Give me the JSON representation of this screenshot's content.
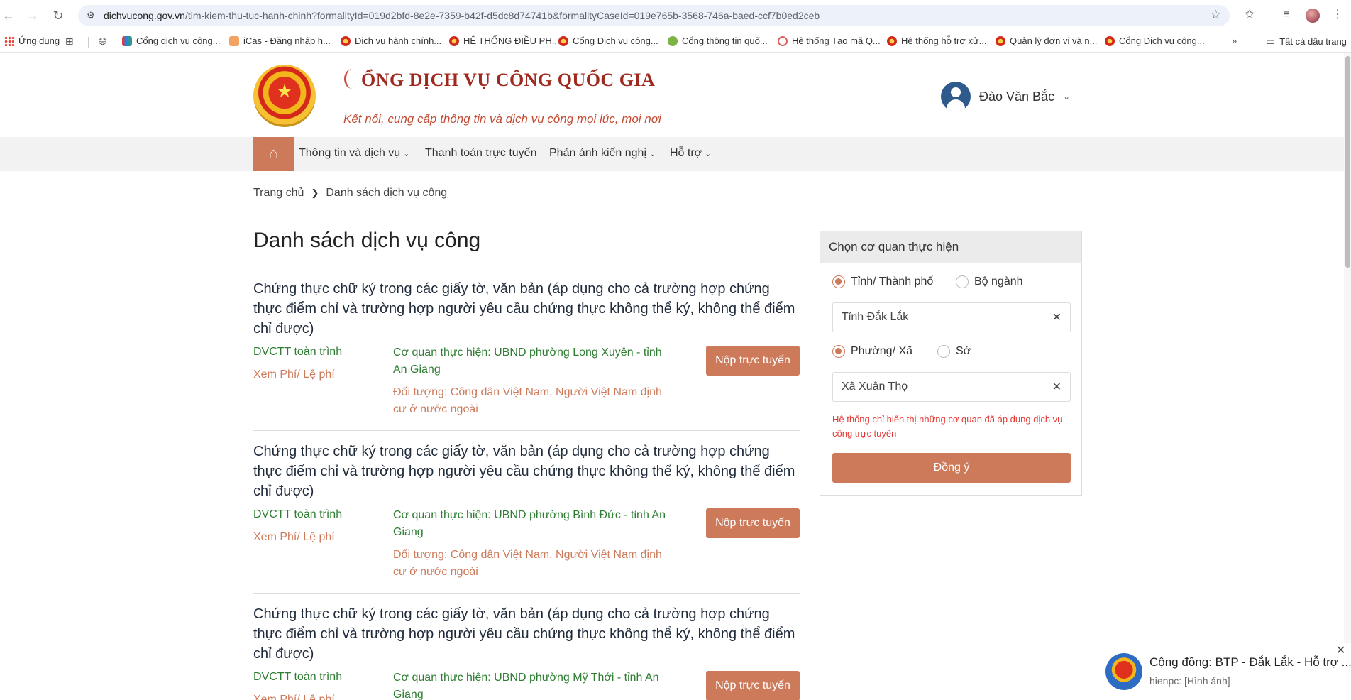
{
  "browser": {
    "url_host": "dichvucong.gov.vn",
    "url_path": "/tim-kiem-thu-tuc-hanh-chinh?formalityId=019d2bfd-8e2e-7359-b42f-d5dc8d74741b&formalityCaseId=019e765b-3568-746a-baed-ccf7b0ed2ceb",
    "bookmarks": [
      {
        "label": "Ứng dụng"
      },
      {
        "label": "Cổng dịch vụ công..."
      },
      {
        "label": "iCas - Đăng nhập h..."
      },
      {
        "label": "Dịch vụ hành chính..."
      },
      {
        "label": "HỆ THỐNG ĐIỀU PH..."
      },
      {
        "label": "Cổng Dịch vụ công..."
      },
      {
        "label": "Cổng thông tin quố..."
      },
      {
        "label": "Hệ thống Tạo mã Q..."
      },
      {
        "label": "Hệ thống hỗ trợ xử..."
      },
      {
        "label": "Quản lý đơn vị và n..."
      },
      {
        "label": "Cổng Dịch vụ công..."
      }
    ],
    "all_bookmarks": "Tất cả dấu trang"
  },
  "header": {
    "logo_text": "ỔNG DỊCH VỤ CÔNG QUỐC GIA",
    "tagline": "Kết nối, cung cấp thông tin và dịch vụ công mọi lúc, mọi nơi",
    "user_name": "Đào Văn Bắc"
  },
  "nav": {
    "items": [
      {
        "label": "Thông tin và dịch vụ"
      },
      {
        "label": "Thanh toán trực tuyến"
      },
      {
        "label": "Phản ánh kiến nghị"
      },
      {
        "label": "Hỗ trợ"
      }
    ]
  },
  "breadcrumb": {
    "home": "Trang chủ",
    "current": "Danh sách dịch vụ công"
  },
  "main": {
    "title": "Danh sách dịch vụ công",
    "services": [
      {
        "name": "Chứng thực chữ ký trong các giấy tờ, văn bản (áp dụng cho cả trường hợp chứng thực điểm chỉ và trường hợp người yêu cầu chứng thực không thể ký, không thể điểm chỉ được)",
        "type": "DVCTT toàn trình",
        "fee": "Xem Phí/ Lệ phí",
        "agency": "Cơ quan thực hiện: UBND phường Long Xuyên - tỉnh An Giang",
        "target": "Đối tượng: Công dân Việt Nam, Người Việt Nam định cư ở nước ngoài",
        "button": "Nộp trực tuyến"
      },
      {
        "name": "Chứng thực chữ ký trong các giấy tờ, văn bản (áp dụng cho cả trường hợp chứng thực điểm chỉ và trường hợp người yêu cầu chứng thực không thể ký, không thể điểm chỉ được)",
        "type": "DVCTT toàn trình",
        "fee": "Xem Phí/ Lệ phí",
        "agency": "Cơ quan thực hiện: UBND phường Bình Đức - tỉnh An Giang",
        "target": "Đối tượng: Công dân Việt Nam, Người Việt Nam định cư ở nước ngoài",
        "button": "Nộp trực tuyến"
      },
      {
        "name": "Chứng thực chữ ký trong các giấy tờ, văn bản (áp dụng cho cả trường hợp chứng thực điểm chỉ và trường hợp người yêu cầu chứng thực không thể ký, không thể điểm chỉ được)",
        "type": "DVCTT toàn trình",
        "fee": "Xem Phí/ Lệ phí",
        "agency": "Cơ quan thực hiện: UBND phường Mỹ Thới - tỉnh An Giang",
        "button": "Nộp trực tuyến"
      }
    ]
  },
  "sidebar": {
    "title": "Chọn cơ quan thực hiện",
    "radio1": {
      "a": "Tỉnh/ Thành phố",
      "b": "Bộ ngành"
    },
    "province": "Tỉnh Đắk Lắk",
    "radio2": {
      "a": "Phường/ Xã",
      "b": "Sở"
    },
    "ward": "Xã Xuân Thọ",
    "note": "Hệ thống chỉ hiển thị những cơ quan đã áp dụng dịch vụ công trực tuyến",
    "submit": "Đồng ý"
  },
  "chat": {
    "title": "Cộng đồng: BTP - Đắk Lắk - Hỗ trợ ...",
    "subtitle": "hienpc: [Hình ảnh]"
  },
  "colors": {
    "accent": "#cd7a5a",
    "green": "#2e7d32",
    "brand_red": "#9e2a1f",
    "note_red": "#e53935"
  }
}
